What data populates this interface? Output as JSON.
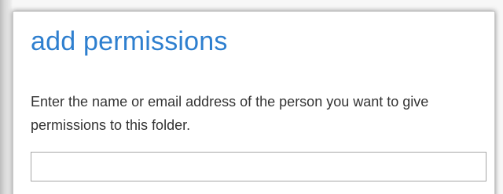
{
  "dialog": {
    "title": "add permissions",
    "instructions": "Enter the name or email address of the person you want to give permissions to this folder.",
    "input": {
      "value": "",
      "placeholder": ""
    }
  },
  "colors": {
    "title": "#2e7fcf",
    "text": "#333333",
    "input_border": "#a6a6a6"
  }
}
